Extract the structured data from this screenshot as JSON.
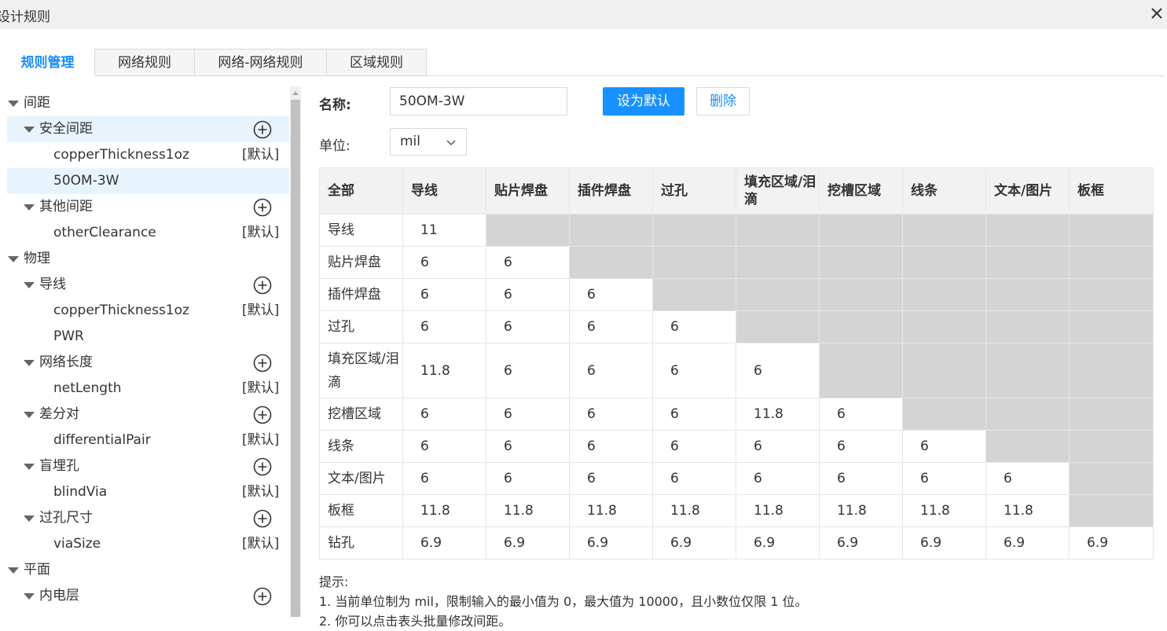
{
  "window": {
    "title": "设计规则"
  },
  "tabs": [
    {
      "label": "规则管理"
    },
    {
      "label": "网络规则"
    },
    {
      "label": "网络-网络规则"
    },
    {
      "label": "区域规则"
    }
  ],
  "tree": [
    {
      "label": "间距",
      "level": 0,
      "expanded": true
    },
    {
      "label": "安全间距",
      "level": 1,
      "expanded": true,
      "add": true,
      "highlight": true
    },
    {
      "label": "copperThickness1oz",
      "level": 2,
      "badge": "[默认]"
    },
    {
      "label": "50OM-3W",
      "level": 2,
      "selected": true
    },
    {
      "label": "其他间距",
      "level": 1,
      "expanded": true,
      "add": true
    },
    {
      "label": "otherClearance",
      "level": 2,
      "badge": "[默认]"
    },
    {
      "label": "物理",
      "level": 0,
      "expanded": true
    },
    {
      "label": "导线",
      "level": 1,
      "expanded": true,
      "add": true
    },
    {
      "label": "copperThickness1oz",
      "level": 2,
      "badge": "[默认]"
    },
    {
      "label": "PWR",
      "level": 2
    },
    {
      "label": "网络长度",
      "level": 1,
      "expanded": true,
      "add": true
    },
    {
      "label": "netLength",
      "level": 2,
      "badge": "[默认]"
    },
    {
      "label": "差分对",
      "level": 1,
      "expanded": true,
      "add": true
    },
    {
      "label": "differentialPair",
      "level": 2,
      "badge": "[默认]"
    },
    {
      "label": "盲埋孔",
      "level": 1,
      "expanded": true,
      "add": true
    },
    {
      "label": "blindVia",
      "level": 2,
      "badge": "[默认]"
    },
    {
      "label": "过孔尺寸",
      "level": 1,
      "expanded": true,
      "add": true
    },
    {
      "label": "viaSize",
      "level": 2,
      "badge": "[默认]"
    },
    {
      "label": "平面",
      "level": 0,
      "expanded": true
    },
    {
      "label": "内电层",
      "level": 1,
      "expanded": true,
      "add": true
    }
  ],
  "form": {
    "name_label": "名称:",
    "name_value": "50OM-3W",
    "set_default_label": "设为默认",
    "delete_label": "删除",
    "unit_label": "单位:",
    "unit_value": "mil"
  },
  "matrix": {
    "corner": "全部",
    "columns": [
      "导线",
      "贴片焊盘",
      "插件焊盘",
      "过孔",
      "填充区域/泪滴",
      "挖槽区域",
      "线条",
      "文本/图片",
      "板框"
    ],
    "rows": [
      {
        "label": "导线",
        "values": [
          "11"
        ]
      },
      {
        "label": "贴片焊盘",
        "values": [
          "6",
          "6"
        ]
      },
      {
        "label": "插件焊盘",
        "values": [
          "6",
          "6",
          "6"
        ]
      },
      {
        "label": "过孔",
        "values": [
          "6",
          "6",
          "6",
          "6"
        ]
      },
      {
        "label": "填充区域/泪滴",
        "values": [
          "11.8",
          "6",
          "6",
          "6",
          "6"
        ]
      },
      {
        "label": "挖槽区域",
        "values": [
          "6",
          "6",
          "6",
          "6",
          "11.8",
          "6"
        ]
      },
      {
        "label": "线条",
        "values": [
          "6",
          "6",
          "6",
          "6",
          "6",
          "6",
          "6"
        ]
      },
      {
        "label": "文本/图片",
        "values": [
          "6",
          "6",
          "6",
          "6",
          "6",
          "6",
          "6",
          "6"
        ]
      },
      {
        "label": "板框",
        "values": [
          "11.8",
          "11.8",
          "11.8",
          "11.8",
          "11.8",
          "11.8",
          "11.8",
          "11.8"
        ]
      },
      {
        "label": "钻孔",
        "values": [
          "6.9",
          "6.9",
          "6.9",
          "6.9",
          "6.9",
          "6.9",
          "6.9",
          "6.9",
          "6.9"
        ]
      }
    ]
  },
  "tips": {
    "heading": "提示:",
    "line1": "1. 当前单位制为 mil，限制输入的最小值为 0，最大值为 10000，且小数位仅限 1 位。",
    "line2": "2. 你可以点击表头批量修改间距。"
  },
  "colors": {
    "accent": "#1890ff",
    "disabled_cell": "#d4d4d4",
    "highlight_row": "#e8f4fd"
  }
}
